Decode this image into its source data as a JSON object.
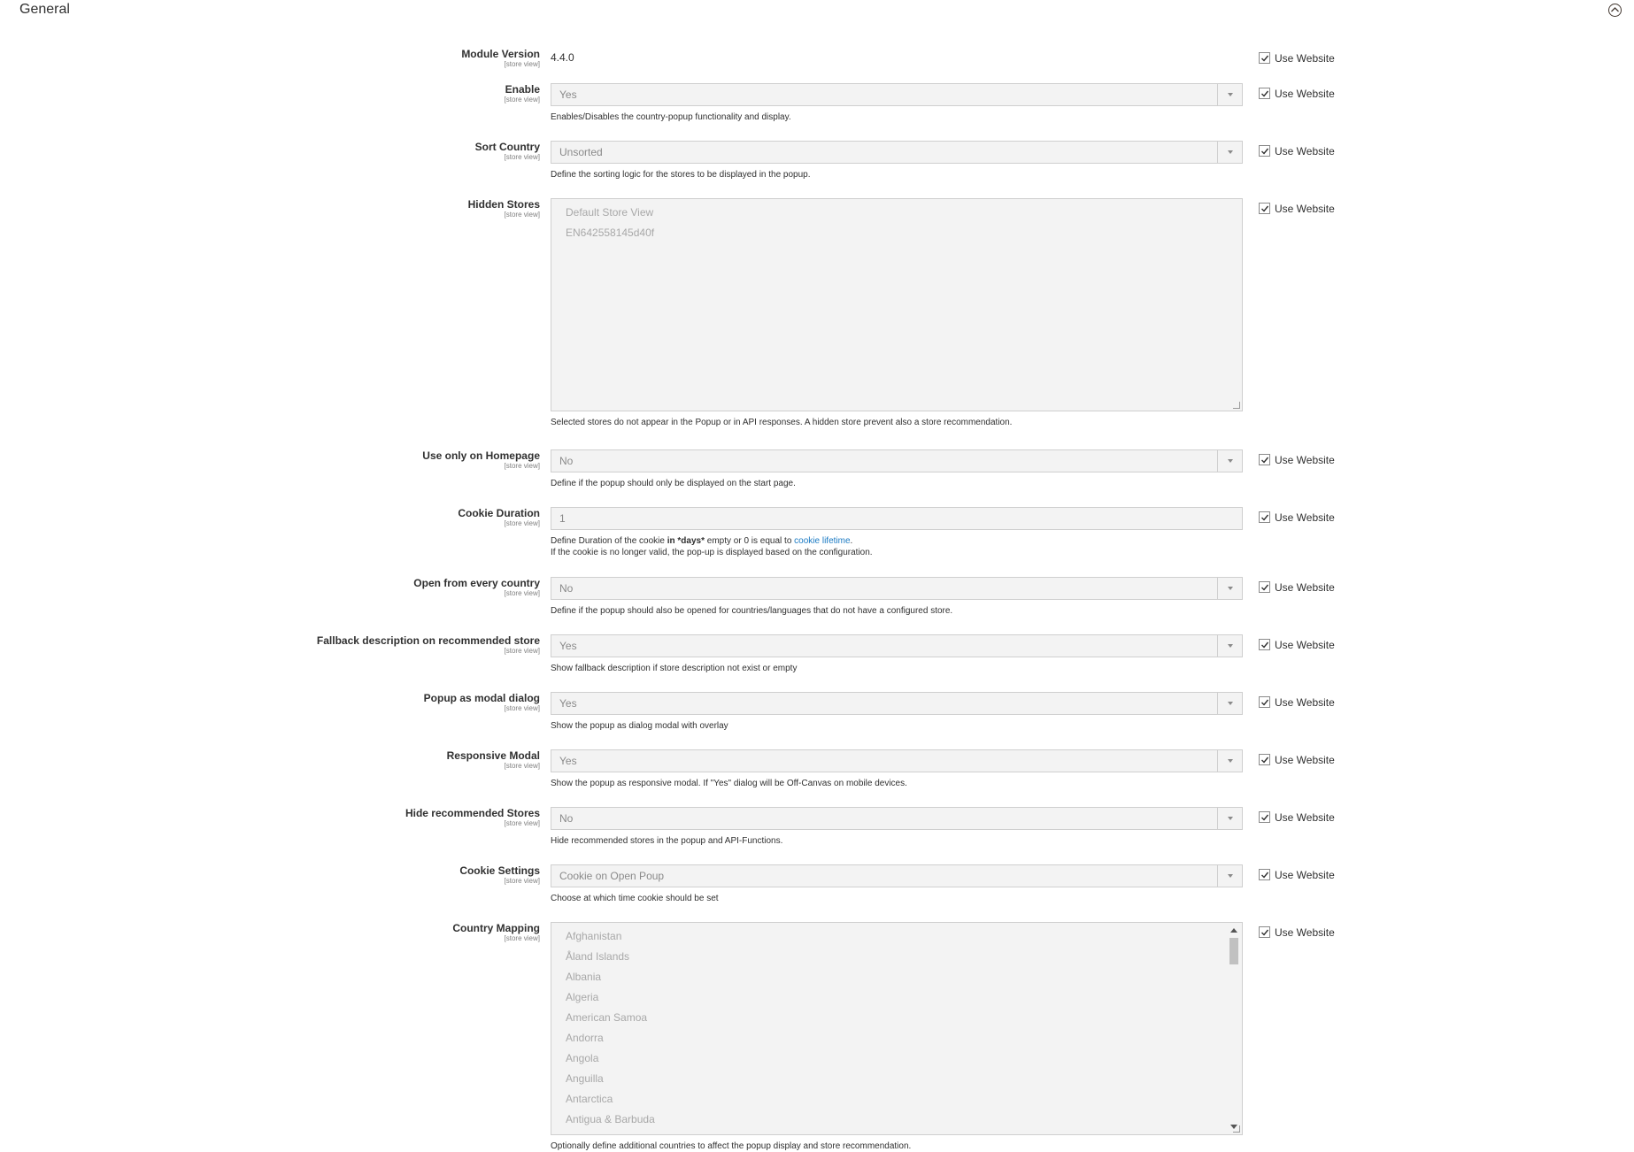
{
  "section": {
    "title": "General"
  },
  "use_website_label": "Use Website",
  "scope_label": "[store view]",
  "module_version": {
    "label": "Module Version",
    "value": "4.4.0"
  },
  "fields": {
    "enable": {
      "label": "Enable",
      "value": "Yes",
      "note": "Enables/Disables the country-popup functionality and display."
    },
    "sort_country": {
      "label": "Sort Country",
      "value": "Unsorted",
      "note": "Define the sorting logic for the stores to be displayed in the popup."
    },
    "hidden_stores": {
      "label": "Hidden Stores",
      "options": [
        "Default Store View",
        "EN642558145d40f"
      ],
      "note": "Selected stores do not appear in the Popup or in API responses. A hidden store prevent also a store recommendation."
    },
    "homepage_only": {
      "label": "Use only on Homepage",
      "value": "No",
      "note": "Define if the popup should only be displayed on the start page."
    },
    "cookie_duration": {
      "label": "Cookie Duration",
      "value": "1",
      "note_pre": "Define Duration of the cookie ",
      "note_bold": "in *days*",
      "note_mid": " empty or 0 is equal to ",
      "note_link": "cookie lifetime",
      "note_post": ".",
      "note_line2": "If the cookie is no longer valid, the pop-up is displayed based on the configuration."
    },
    "open_every_country": {
      "label": "Open from every country",
      "value": "No",
      "note": "Define if the popup should also be opened for countries/languages that do not have a configured store."
    },
    "fallback_description": {
      "label": "Fallback description on recommended store",
      "value": "Yes",
      "note": "Show fallback description if store description not exist or empty"
    },
    "popup_modal": {
      "label": "Popup as modal dialog",
      "value": "Yes",
      "note": "Show the popup as dialog modal with overlay"
    },
    "responsive_modal": {
      "label": "Responsive Modal",
      "value": "Yes",
      "note": "Show the popup as responsive modal. If \"Yes\" dialog will be Off-Canvas on mobile devices."
    },
    "hide_recommended": {
      "label": "Hide recommended Stores",
      "value": "No",
      "note": "Hide recommended stores in the popup and API-Functions."
    },
    "cookie_settings": {
      "label": "Cookie Settings",
      "value": "Cookie on Open Poup",
      "note": "Choose at which time cookie should be set"
    },
    "country_mapping": {
      "label": "Country Mapping",
      "options": [
        "Afghanistan",
        "Åland Islands",
        "Albania",
        "Algeria",
        "American Samoa",
        "Andorra",
        "Angola",
        "Anguilla",
        "Antarctica",
        "Antigua & Barbuda"
      ],
      "note": "Optionally define additional countries to affect the popup display and store recommendation."
    }
  }
}
